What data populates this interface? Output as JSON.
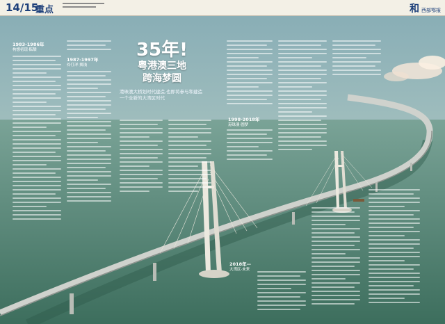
{
  "header": {
    "page_number": "14/15",
    "section": "重点",
    "masthead": "和",
    "masthead_sub": "西部鄂报"
  },
  "headline": {
    "main": "35年!",
    "sub1": "粤港澳三地",
    "sub2": "跨海梦圆",
    "deck": "港珠澳大桥划时代建造,也即将参与和建造一个全新的大湾区时代"
  },
  "sections": [
    {
      "era": "1983-1986年",
      "label": "构想初现·酝酿"
    },
    {
      "era": "1987-1997年",
      "label": "伶仃洋·搁浅"
    },
    {
      "era": "1998-2018年",
      "label": "港珠澳·圆梦"
    },
    {
      "era": "2018年—",
      "label": "大湾区·未来"
    }
  ],
  "colors": {
    "sky_top": "#7fa7b2",
    "sea": "#5f8f86",
    "bridge_deck": "#c9ccc8",
    "pylon": "#e9e6dc",
    "headline_text": "#ffffff",
    "header_bg": "#f3f0e6",
    "header_text": "#1d3f7a"
  }
}
